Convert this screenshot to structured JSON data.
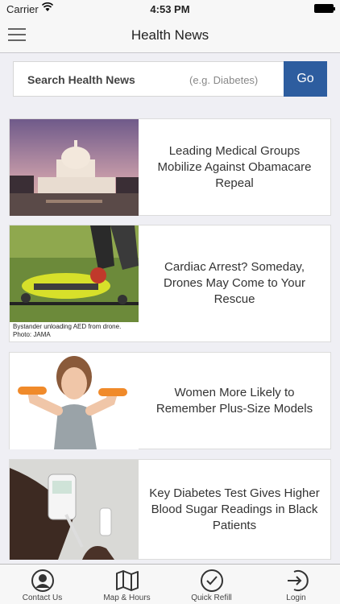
{
  "status_bar": {
    "carrier": "Carrier",
    "time": "4:53 PM"
  },
  "nav": {
    "title": "Health News",
    "menu_icon": "hamburger-menu-icon"
  },
  "search": {
    "label": "Search Health News",
    "hint": "(e.g. Diabetes)",
    "go": "Go",
    "go_color": "#2d5d9f"
  },
  "articles": [
    {
      "headline": "Leading Medical Groups Mobilize Against Obamacare Repeal",
      "image": "capitol-building-photo"
    },
    {
      "headline": "Cardiac Arrest? Someday, Drones May Come to Your Rescue",
      "image": "drone-photo",
      "caption": "Bystander unloading AED from drone.  Photo:  JAMA"
    },
    {
      "headline": "Women More Likely to Remember Plus-Size Models",
      "image": "woman-dumbbells-photo"
    },
    {
      "headline": "Key Diabetes Test Gives Higher Blood Sugar Readings in Black Patients",
      "image": "glucose-meter-photo"
    }
  ],
  "tabs": [
    {
      "label": "Contact Us",
      "icon": "person-icon"
    },
    {
      "label": "Map & Hours",
      "icon": "map-icon"
    },
    {
      "label": "Quick Refill",
      "icon": "checkmark-icon"
    },
    {
      "label": "Login",
      "icon": "login-icon"
    }
  ]
}
